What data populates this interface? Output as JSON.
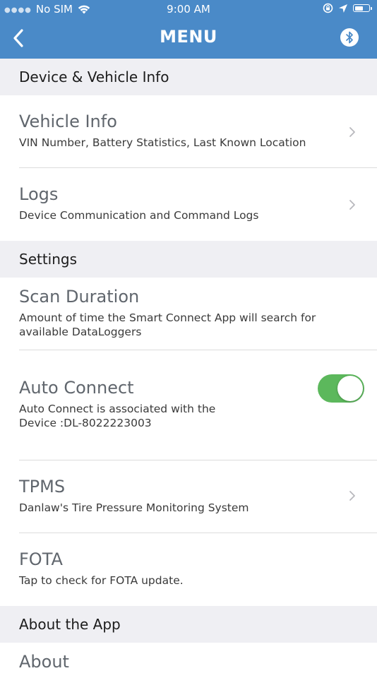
{
  "status_bar": {
    "carrier": "No SIM",
    "time": "9:00 AM"
  },
  "nav": {
    "title": "MENU",
    "back_icon": "chevron-left-icon",
    "bluetooth_icon": "bluetooth-icon"
  },
  "colors": {
    "header_bg": "#4a8ac8",
    "section_bg": "#efeff3",
    "toggle_on": "#5cb85c",
    "title_text": "#60666d"
  },
  "sections": [
    {
      "header": "Device & Vehicle Info",
      "items": [
        {
          "title": "Vehicle Info",
          "subtitle": "VIN Number, Battery Statistics, Last Known Location"
        },
        {
          "title": "Logs",
          "subtitle": "Device Communication and Command Logs"
        }
      ]
    },
    {
      "header": "Settings",
      "items": [
        {
          "title": "Scan Duration",
          "subtitle": "Amount of time the Smart Connect App will search for available DataLoggers"
        },
        {
          "title": "Auto Connect",
          "subtitle": "Auto Connect is associated with the Device :DL-8022223003",
          "toggle_on": true
        },
        {
          "title": "TPMS",
          "subtitle": "Danlaw's Tire Pressure Monitoring System"
        },
        {
          "title": "FOTA",
          "subtitle": "Tap to check for FOTA update."
        }
      ]
    },
    {
      "header": "About the App",
      "items": [
        {
          "title": "About"
        }
      ]
    }
  ]
}
